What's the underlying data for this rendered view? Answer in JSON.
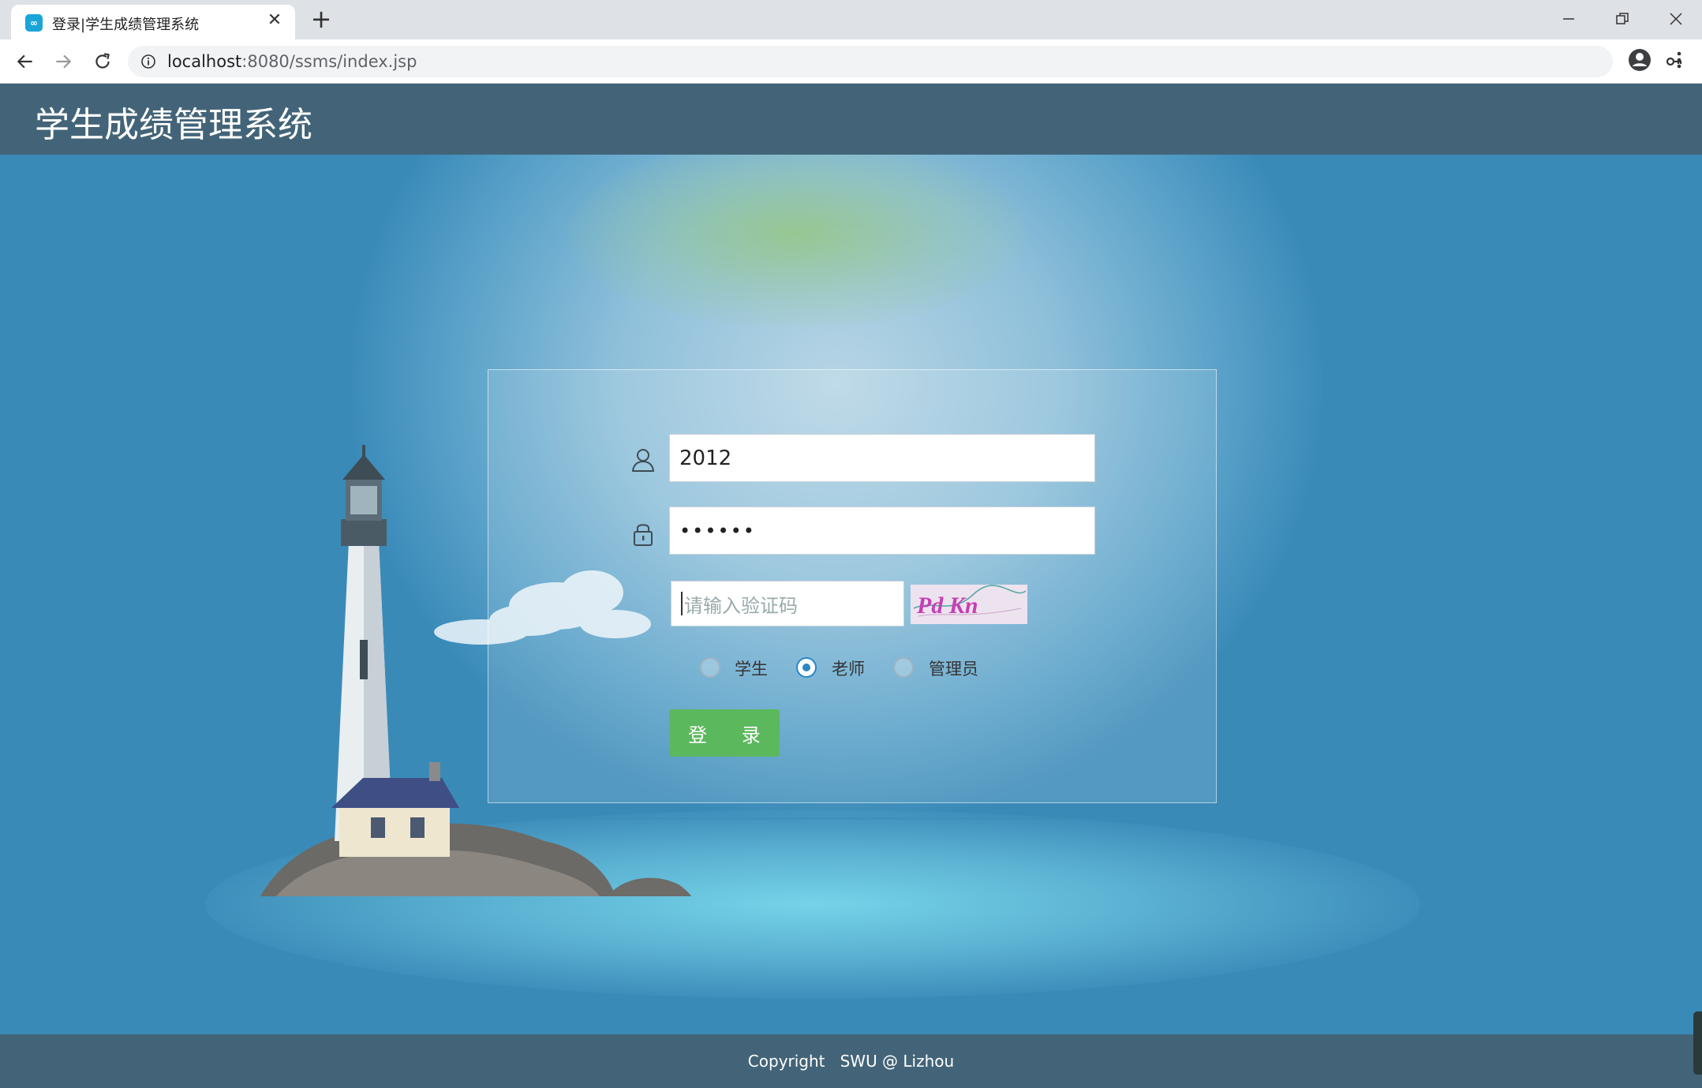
{
  "browser": {
    "tab_title": "登录|学生成绩管理系统",
    "tab_favicon_text": "∞",
    "tab_close": "✕",
    "new_tab": "+",
    "url_host": "localhost",
    "url_path": ":8080/ssms/index.jsp"
  },
  "header": {
    "title": "学生成绩管理系统"
  },
  "login": {
    "username_value": "2012",
    "password_value": "••••••",
    "captcha_placeholder": "请输入验证码",
    "captcha_text": "Pd Kn",
    "roles": [
      {
        "label": "学生",
        "checked": false
      },
      {
        "label": "老师",
        "checked": true
      },
      {
        "label": "管理员",
        "checked": false
      }
    ],
    "login_button": "登 录"
  },
  "footer": {
    "copyright": "Copyright   SWU @ Lizhou"
  },
  "colors": {
    "header": "#436478",
    "footer": "#436478",
    "login_button": "#5cb85c",
    "radio_checked": "#2b86c4"
  }
}
